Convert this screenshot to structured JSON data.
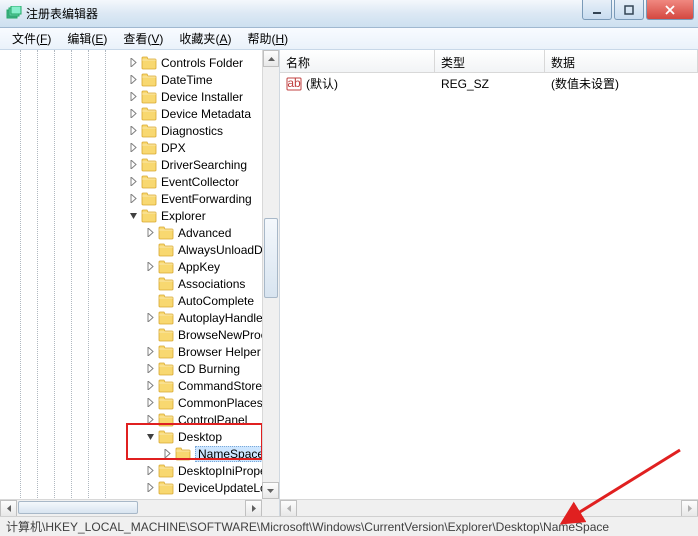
{
  "window": {
    "title": "注册表编辑器"
  },
  "menu": {
    "file": {
      "label": "文件",
      "accel": "F"
    },
    "edit": {
      "label": "编辑",
      "accel": "E"
    },
    "view": {
      "label": "查看",
      "accel": "V"
    },
    "favorites": {
      "label": "收藏夹",
      "accel": "A"
    },
    "help": {
      "label": "帮助",
      "accel": "H"
    }
  },
  "tree": {
    "items": [
      {
        "label": "Controls Folder",
        "indent": 128,
        "tw": "expand"
      },
      {
        "label": "DateTime",
        "indent": 128,
        "tw": "expand"
      },
      {
        "label": "Device Installer",
        "indent": 128,
        "tw": "expand"
      },
      {
        "label": "Device Metadata",
        "indent": 128,
        "tw": "expand"
      },
      {
        "label": "Diagnostics",
        "indent": 128,
        "tw": "expand"
      },
      {
        "label": "DPX",
        "indent": 128,
        "tw": "expand"
      },
      {
        "label": "DriverSearching",
        "indent": 128,
        "tw": "expand"
      },
      {
        "label": "EventCollector",
        "indent": 128,
        "tw": "expand"
      },
      {
        "label": "EventForwarding",
        "indent": 128,
        "tw": "expand"
      },
      {
        "label": "Explorer",
        "indent": 128,
        "tw": "collapse"
      },
      {
        "label": "Advanced",
        "indent": 145,
        "tw": "expand"
      },
      {
        "label": "AlwaysUnloadDLL",
        "indent": 145,
        "tw": "none"
      },
      {
        "label": "AppKey",
        "indent": 145,
        "tw": "expand"
      },
      {
        "label": "Associations",
        "indent": 145,
        "tw": "none"
      },
      {
        "label": "AutoComplete",
        "indent": 145,
        "tw": "none"
      },
      {
        "label": "AutoplayHandlers",
        "indent": 145,
        "tw": "expand"
      },
      {
        "label": "BrowseNewProcess",
        "indent": 145,
        "tw": "none"
      },
      {
        "label": "Browser Helper Ob",
        "indent": 145,
        "tw": "expand"
      },
      {
        "label": "CD Burning",
        "indent": 145,
        "tw": "expand"
      },
      {
        "label": "CommandStore",
        "indent": 145,
        "tw": "expand"
      },
      {
        "label": "CommonPlaces",
        "indent": 145,
        "tw": "expand"
      },
      {
        "label": "ControlPanel",
        "indent": 145,
        "tw": "expand"
      },
      {
        "label": "Desktop",
        "indent": 145,
        "tw": "collapse"
      },
      {
        "label": "NameSpace",
        "indent": 162,
        "tw": "expand",
        "selected": true
      },
      {
        "label": "DesktopIniProperty",
        "indent": 145,
        "tw": "expand"
      },
      {
        "label": "DeviceUpdateLocati",
        "indent": 145,
        "tw": "expand"
      }
    ]
  },
  "list": {
    "columns": {
      "name": "名称",
      "type": "类型",
      "data": "数据"
    },
    "rows": [
      {
        "name": "(默认)",
        "type": "REG_SZ",
        "data": "(数值未设置)",
        "icon": "string"
      }
    ]
  },
  "statusbar": {
    "path": "计算机\\HKEY_LOCAL_MACHINE\\SOFTWARE\\Microsoft\\Windows\\CurrentVersion\\Explorer\\Desktop\\NameSpace"
  }
}
